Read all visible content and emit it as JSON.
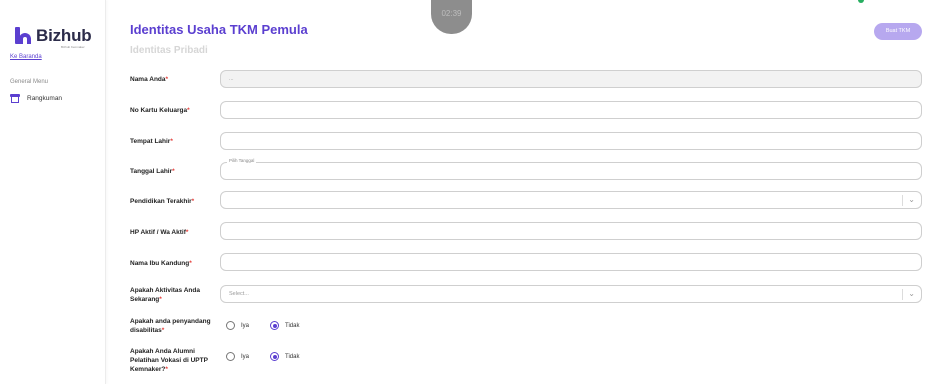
{
  "sidebar": {
    "logo_text": "Bizhub",
    "logo_sub": "Bizhub Kemnaker",
    "home_link": "Ke Baranda",
    "menu_heading": "General Menu",
    "items": [
      {
        "label": "Rangkuman",
        "icon": "store-icon"
      }
    ]
  },
  "header": {
    "title": "Identitas Usaha TKM Pemula",
    "section": "Identitas Pribadi",
    "timer": "02:39",
    "button": "Buat TKM"
  },
  "form": {
    "nama": {
      "label": "Nama Anda",
      "value": "..."
    },
    "kk": {
      "label": "No Kartu Keluarga"
    },
    "tempat_lahir": {
      "label": "Tempat Lahir"
    },
    "tanggal_lahir": {
      "label": "Tanggal Lahir",
      "legend": "Pilih Tanggal"
    },
    "pendidikan": {
      "label": "Pendidikan Terakhir"
    },
    "hp": {
      "label": "HP Aktif / Wa Aktif"
    },
    "ibu": {
      "label": "Nama Ibu Kandung"
    },
    "aktivitas": {
      "label_line1": "Apakah Aktivitas Anda",
      "label_line2": "Sekarang",
      "placeholder": "Select..."
    },
    "disabilitas": {
      "label_line1": "Apakah anda penyandang",
      "label_line2": "disabilitas",
      "options": [
        "Iya",
        "Tidak"
      ],
      "selected": "Tidak"
    },
    "alumni": {
      "label_line1": "Apakah Anda Alumni",
      "label_line2": "Pelatihan Vokasi di UPTP",
      "label_line3": "Kemnaker?",
      "options": [
        "Iya",
        "Tidak"
      ],
      "selected": "Tidak"
    }
  },
  "required_mark": "*",
  "colors": {
    "accent": "#5b3fd0",
    "button": "#b7a8ef",
    "required": "#e53935"
  }
}
